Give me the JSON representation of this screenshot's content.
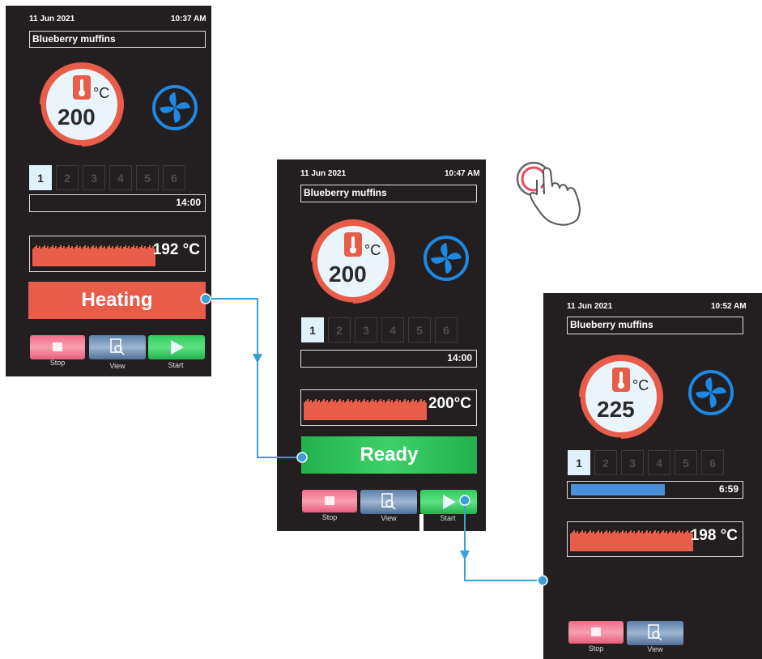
{
  "colors": {
    "screen_bg": "#231f20",
    "accent_red": "#e85c4a",
    "accent_green": "#22b14c",
    "accent_blue": "#4a90d9",
    "connector": "#3aa0d8",
    "fan_blue": "#1e88e5"
  },
  "screens": [
    {
      "date": "11 Jun 2021",
      "time": "10:37 AM",
      "program": "Blueberry muffins",
      "set_temp": "200",
      "unit": "°C",
      "steps": [
        "1",
        "2",
        "3",
        "4",
        "5",
        "6"
      ],
      "active_step": 1,
      "timer": "14:00",
      "current_temp": "192 °C",
      "status": "Heating",
      "buttons": {
        "stop": "Stop",
        "view": "View",
        "start": "Start"
      }
    },
    {
      "date": "11 Jun 2021",
      "time": "10:47 AM",
      "program": "Blueberry muffins",
      "set_temp": "200",
      "unit": "°C",
      "steps": [
        "1",
        "2",
        "3",
        "4",
        "5",
        "6"
      ],
      "active_step": 1,
      "timer": "14:00",
      "current_temp": "200°C",
      "status": "Ready",
      "buttons": {
        "stop": "Stop",
        "view": "View",
        "start": "Start"
      }
    },
    {
      "date": "11 Jun 2021",
      "time": "10:52 AM",
      "program": "Blueberry muffins",
      "set_temp": "225",
      "unit": "°C",
      "steps": [
        "1",
        "2",
        "3",
        "4",
        "5",
        "6"
      ],
      "active_step": 1,
      "timer": "6:59",
      "timer_progress": 0.55,
      "current_temp": "198 °C",
      "buttons": {
        "stop": "Stop",
        "view": "View"
      }
    }
  ],
  "icons": {
    "thermometer": "thermometer-icon",
    "fan": "fan-icon",
    "stop": "stop-icon",
    "view": "view-icon",
    "start": "play-icon",
    "tap": "touch-hand-icon"
  }
}
